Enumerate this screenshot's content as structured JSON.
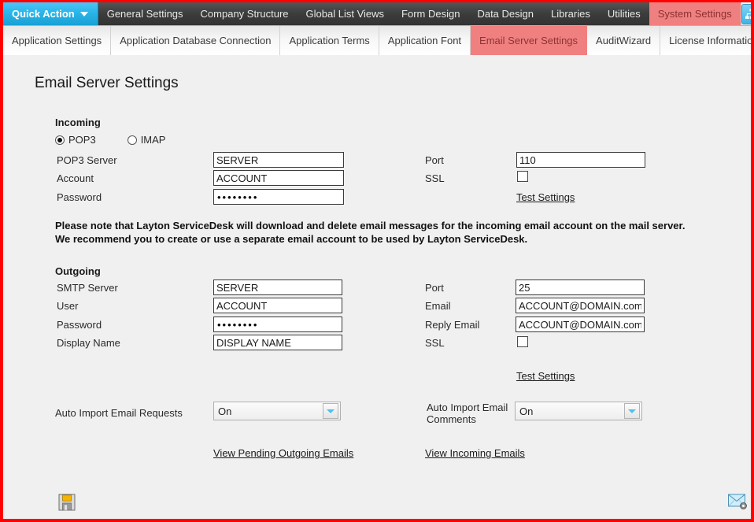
{
  "window": {
    "title": "Email Server Settings"
  },
  "menubar": {
    "quick_action": {
      "label": "Quick Action",
      "icon": "chevron-down-icon"
    },
    "items": [
      {
        "label": "General Settings",
        "active": false
      },
      {
        "label": "Company Structure",
        "active": false
      },
      {
        "label": "Global List Views",
        "active": false
      },
      {
        "label": "Form Design",
        "active": false
      },
      {
        "label": "Data Design",
        "active": false
      },
      {
        "label": "Libraries",
        "active": false
      },
      {
        "label": "Utilities",
        "active": false
      },
      {
        "label": "System Settings",
        "active": true
      }
    ],
    "right_icon": "org-chart-icon"
  },
  "tabs": [
    {
      "label": "Application Settings",
      "active": false
    },
    {
      "label": "Application Database Connection",
      "active": false
    },
    {
      "label": "Application Terms",
      "active": false
    },
    {
      "label": "Application Font",
      "active": false
    },
    {
      "label": "Email Server Settings",
      "active": true
    },
    {
      "label": "AuditWizard",
      "active": false
    },
    {
      "label": "License Information",
      "active": false
    }
  ],
  "page": {
    "title": "Email Server Settings"
  },
  "incoming": {
    "heading": "Incoming",
    "protocol_options": [
      {
        "label": "POP3",
        "selected": true
      },
      {
        "label": "IMAP",
        "selected": false
      }
    ],
    "server_label": "POP3 Server",
    "server_value": "SERVER",
    "account_label": "Account",
    "account_value": "ACCOUNT",
    "password_label": "Password",
    "password_value": "••••••••",
    "port_label": "Port",
    "port_value": "110",
    "ssl_label": "SSL",
    "ssl_checked": false,
    "test_settings_label": "Test Settings"
  },
  "note": {
    "line1": "Please note that Layton ServiceDesk will download and delete email messages for the incoming email account on the mail server.",
    "line2": "We recommend you to create or use a separate email account to be used by Layton ServiceDesk."
  },
  "outgoing": {
    "heading": "Outgoing",
    "smtp_label": "SMTP Server",
    "smtp_value": "SERVER",
    "user_label": "User",
    "user_value": "ACCOUNT",
    "password_label": "Password",
    "password_value": "••••••••",
    "display_name_label": "Display Name",
    "display_name_value": "DISPLAY NAME",
    "port_label": "Port",
    "port_value": "25",
    "email_label": "Email",
    "email_value": "ACCOUNT@DOMAIN.com",
    "reply_email_label": "Reply Email",
    "reply_email_value": "ACCOUNT@DOMAIN.com",
    "ssl_label": "SSL",
    "ssl_checked": false,
    "test_settings_label": "Test Settings"
  },
  "automation": {
    "requests_label": "Auto Import Email Requests",
    "requests_value": "On",
    "comments_label_line1": "Auto Import Email",
    "comments_label_line2": "Comments",
    "comments_value": "On",
    "view_pending_link": "View Pending Outgoing Emails",
    "view_incoming_link": "View Incoming Emails"
  },
  "footer": {
    "save_icon": "save-floppy-icon",
    "mail_settings_icon": "email-settings-icon"
  },
  "colors": {
    "accent_blue": "#29b6e8",
    "active_tab": "#f08080",
    "border_red": "#ff0000",
    "menubar_dark": "#3c3c3c",
    "content_bg": "#f0f0f0"
  }
}
